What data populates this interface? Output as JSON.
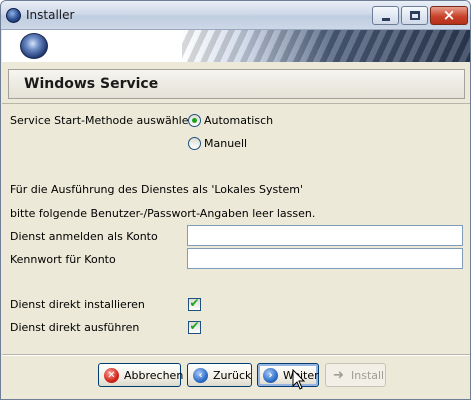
{
  "window": {
    "title": "Installer",
    "controls": {
      "minimize": "minimize",
      "maximize": "maximize",
      "close": "×"
    }
  },
  "section": {
    "title": "Windows Service"
  },
  "start_method": {
    "label": "Service Start-Methode auswählen",
    "options": [
      {
        "label": "Automatisch",
        "selected": true
      },
      {
        "label": "Manuell",
        "selected": false
      }
    ]
  },
  "info": {
    "line1": "Für die Ausführung des Dienstes als 'Lokales System'",
    "line2": "bitte folgende Benutzer-/Passwort-Angaben leer lassen."
  },
  "account": {
    "label": "Dienst anmelden als Konto",
    "value": ""
  },
  "password": {
    "label": "Kennwort für Konto",
    "value": ""
  },
  "options": {
    "install_now": {
      "label": "Dienst direkt installieren",
      "checked": true
    },
    "run_now": {
      "label": "Dienst direkt ausführen",
      "checked": true
    }
  },
  "buttons": {
    "cancel": "Abbrechen",
    "back": "Zurück",
    "next": "Weiter",
    "install": "Install"
  },
  "colors": {
    "accent": "#2e6ec9",
    "window_bg": "#ece9d8",
    "check_green": "#21a121"
  }
}
